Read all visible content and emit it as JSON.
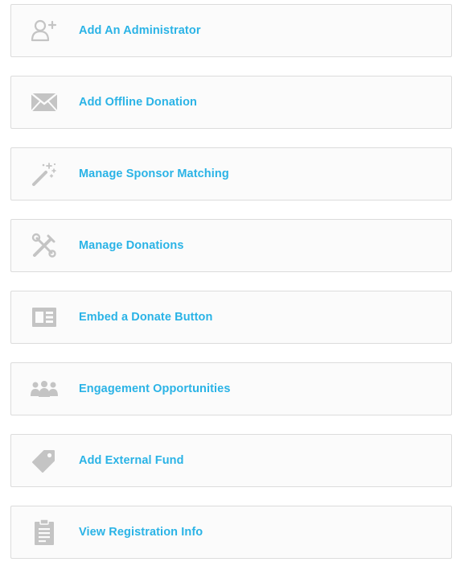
{
  "theme": {
    "accent": "#2ab3e6",
    "icon_color": "#c4c4c4",
    "border": "#dcdcdc",
    "background": "#fbfbfb"
  },
  "actions": [
    {
      "label": "Add An Administrator",
      "icon": "add-user-icon"
    },
    {
      "label": "Add Offline Donation",
      "icon": "envelope-icon"
    },
    {
      "label": "Manage Sponsor Matching",
      "icon": "magic-wand-icon"
    },
    {
      "label": "Manage Donations",
      "icon": "tools-icon"
    },
    {
      "label": "Embed a Donate Button",
      "icon": "embed-card-icon"
    },
    {
      "label": "Engagement Opportunities",
      "icon": "people-group-icon"
    },
    {
      "label": "Add External Fund",
      "icon": "tag-icon"
    },
    {
      "label": "View Registration Info",
      "icon": "clipboard-icon"
    }
  ]
}
